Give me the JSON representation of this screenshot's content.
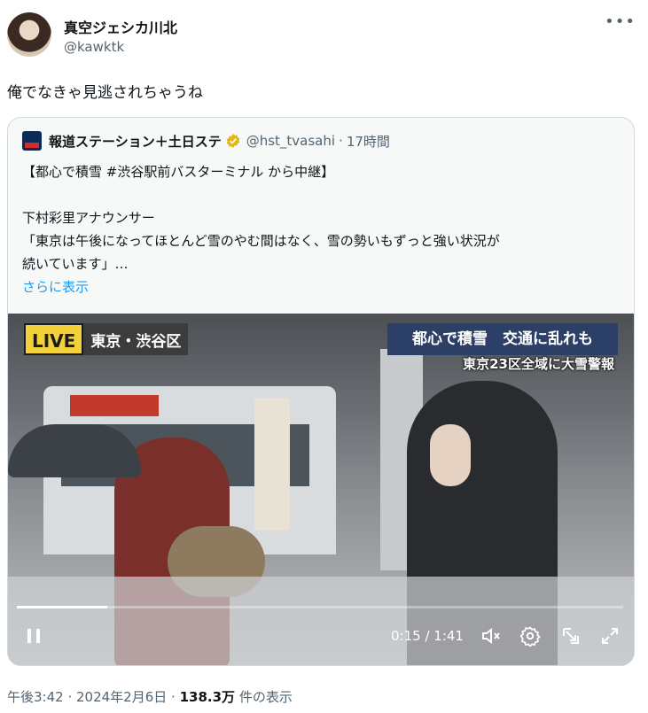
{
  "author": {
    "display_name": "真空ジェシカ川北",
    "handle": "@kawktk"
  },
  "post_text": "俺でなきゃ見逃されちゃうね",
  "quoted": {
    "name": "報道ステーション＋土日ステ",
    "handle": "@hst_tvasahi",
    "separator": "·",
    "time": "17時間",
    "lines": [
      "【都心で積雪 #渋谷駅前バスターミナル から中継】",
      "",
      "下村彩里アナウンサー",
      "「東京は午後になってほとんど雪のやむ間はなく、雪の勢いもずっと強い状況が",
      "続いています」…"
    ],
    "show_more": "さらに表示"
  },
  "video": {
    "live_label": "LIVE",
    "location": "東京・渋谷区",
    "headline": "都心で積雪　交通に乱れも",
    "warning": "東京23区全域に大雪警報",
    "time_display": "0:15 / 1:41",
    "progress_fraction": 0.149
  },
  "footer": {
    "timestamp": "午後3:42 · 2024年2月6日 ·",
    "views": "138.3万",
    "views_label": "件の表示"
  },
  "colors": {
    "link": "#1d9bf0",
    "live_yellow": "#f2d13b",
    "headline_bg": "#2c3f66",
    "verified_gold": "#e2b719"
  }
}
